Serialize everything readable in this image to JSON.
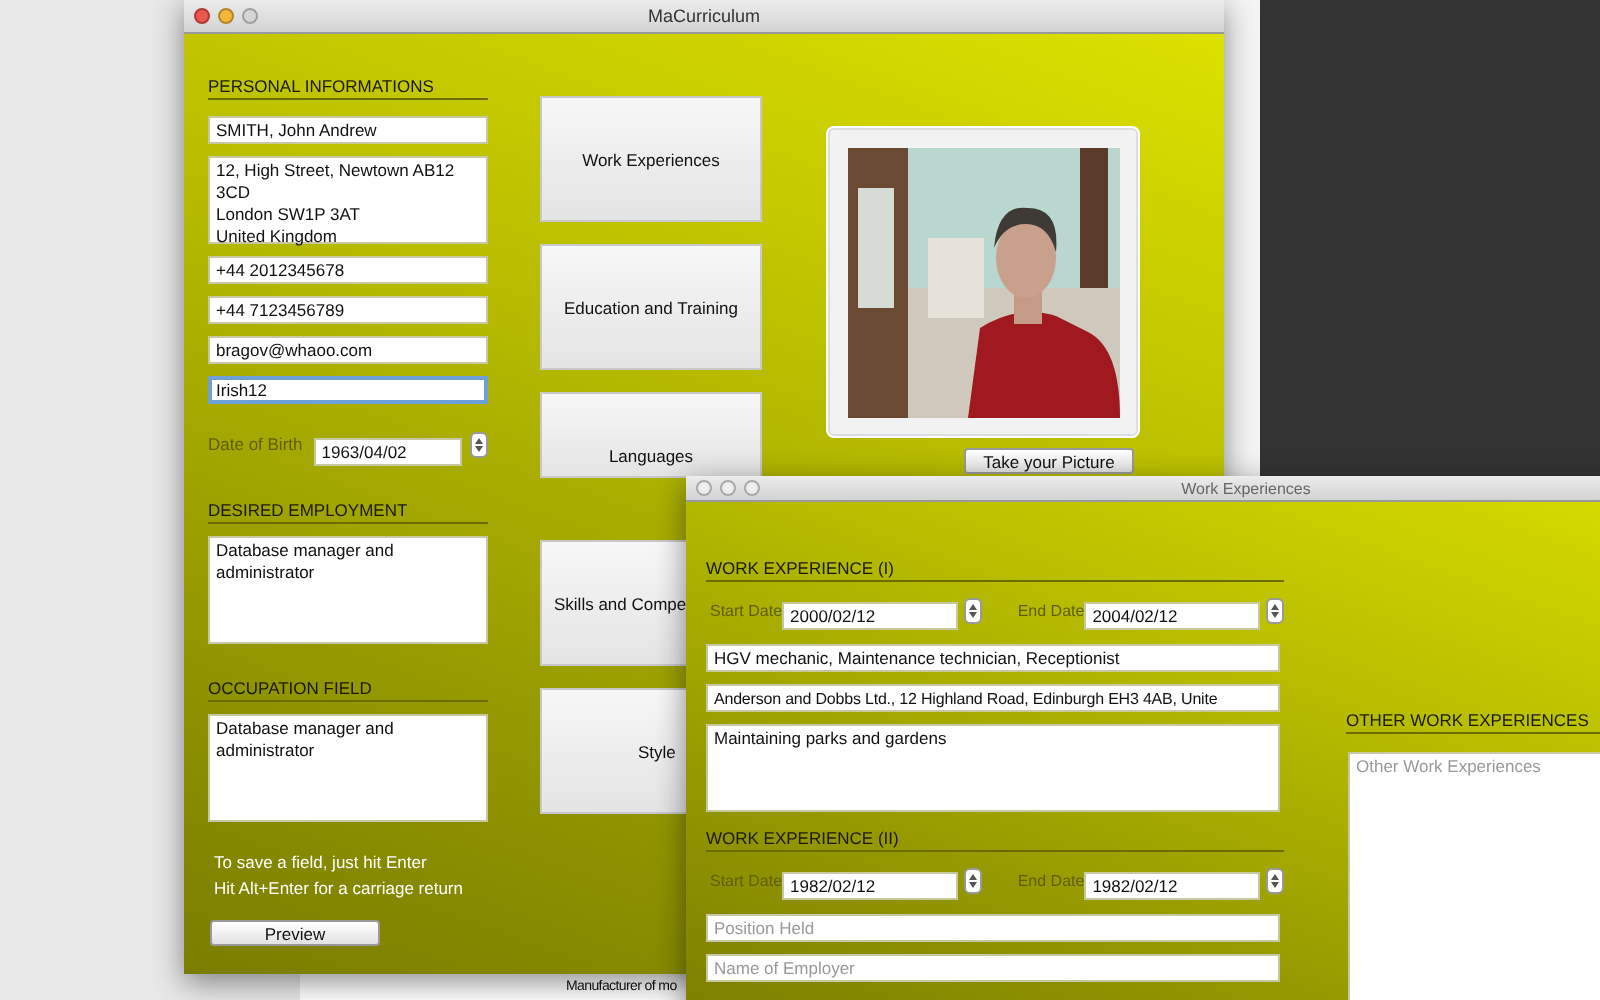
{
  "main_window": {
    "title": "MaCurriculum",
    "personal": {
      "heading": "PERSONAL INFORMATIONS",
      "fields": [
        {
          "kind": "line",
          "value": "SMITH, John Andrew",
          "focused": false
        },
        {
          "kind": "area",
          "value": "12, High Street, Newtown AB12 3CD\nLondon SW1P 3AT\nUnited Kingdom",
          "focused": false
        },
        {
          "kind": "line",
          "value": "+44 2012345678",
          "focused": false
        },
        {
          "kind": "line",
          "value": "+44 7123456789",
          "focused": false
        },
        {
          "kind": "line",
          "value": "bragov@whaoo.com",
          "focused": false
        },
        {
          "kind": "line",
          "value": "Irish12",
          "focused": true
        }
      ],
      "birth": {
        "label": "Date of Birth",
        "value": "1963/04/02"
      }
    },
    "desired": {
      "heading": "DESIRED EMPLOYMENT",
      "value": "Database manager and administrator"
    },
    "occupation": {
      "heading": "OCCUPATION FIELD",
      "value": "Database manager and administrator"
    },
    "notes": [
      "To save a field, just hit Enter",
      "Hit Alt+Enter for a carriage return"
    ],
    "preview_button": "Preview",
    "sections": [
      "Work Experiences",
      "Education and Training",
      "Languages",
      "Skills and Compe",
      "Style"
    ],
    "take_picture_button": "Take your Picture"
  },
  "footer_text": "Manufacturer of mo",
  "work_window": {
    "title": "Work Experiences",
    "experiences": [
      {
        "heading": "WORK EXPERIENCE (I)",
        "start_label": "Start Date",
        "start": "2000/02/12",
        "end_label": "End Date",
        "end": "2004/02/12",
        "position": "HGV mechanic, Maintenance technician, Receptionist",
        "employer": "Anderson and Dobbs Ltd., 12 Highland Road, Edinburgh EH3 4AB, Unite",
        "description": "Maintaining parks and gardens"
      },
      {
        "heading": "WORK EXPERIENCE (II)",
        "start_label": "Start Date",
        "start": "1982/02/12",
        "end_label": "End Date",
        "end": "1982/02/12",
        "position_placeholder": "Position Held",
        "employer_placeholder": "Name of Employer"
      }
    ],
    "other": {
      "heading": "OTHER WORK EXPERIENCES",
      "placeholder": "Other Work Experiences"
    }
  }
}
